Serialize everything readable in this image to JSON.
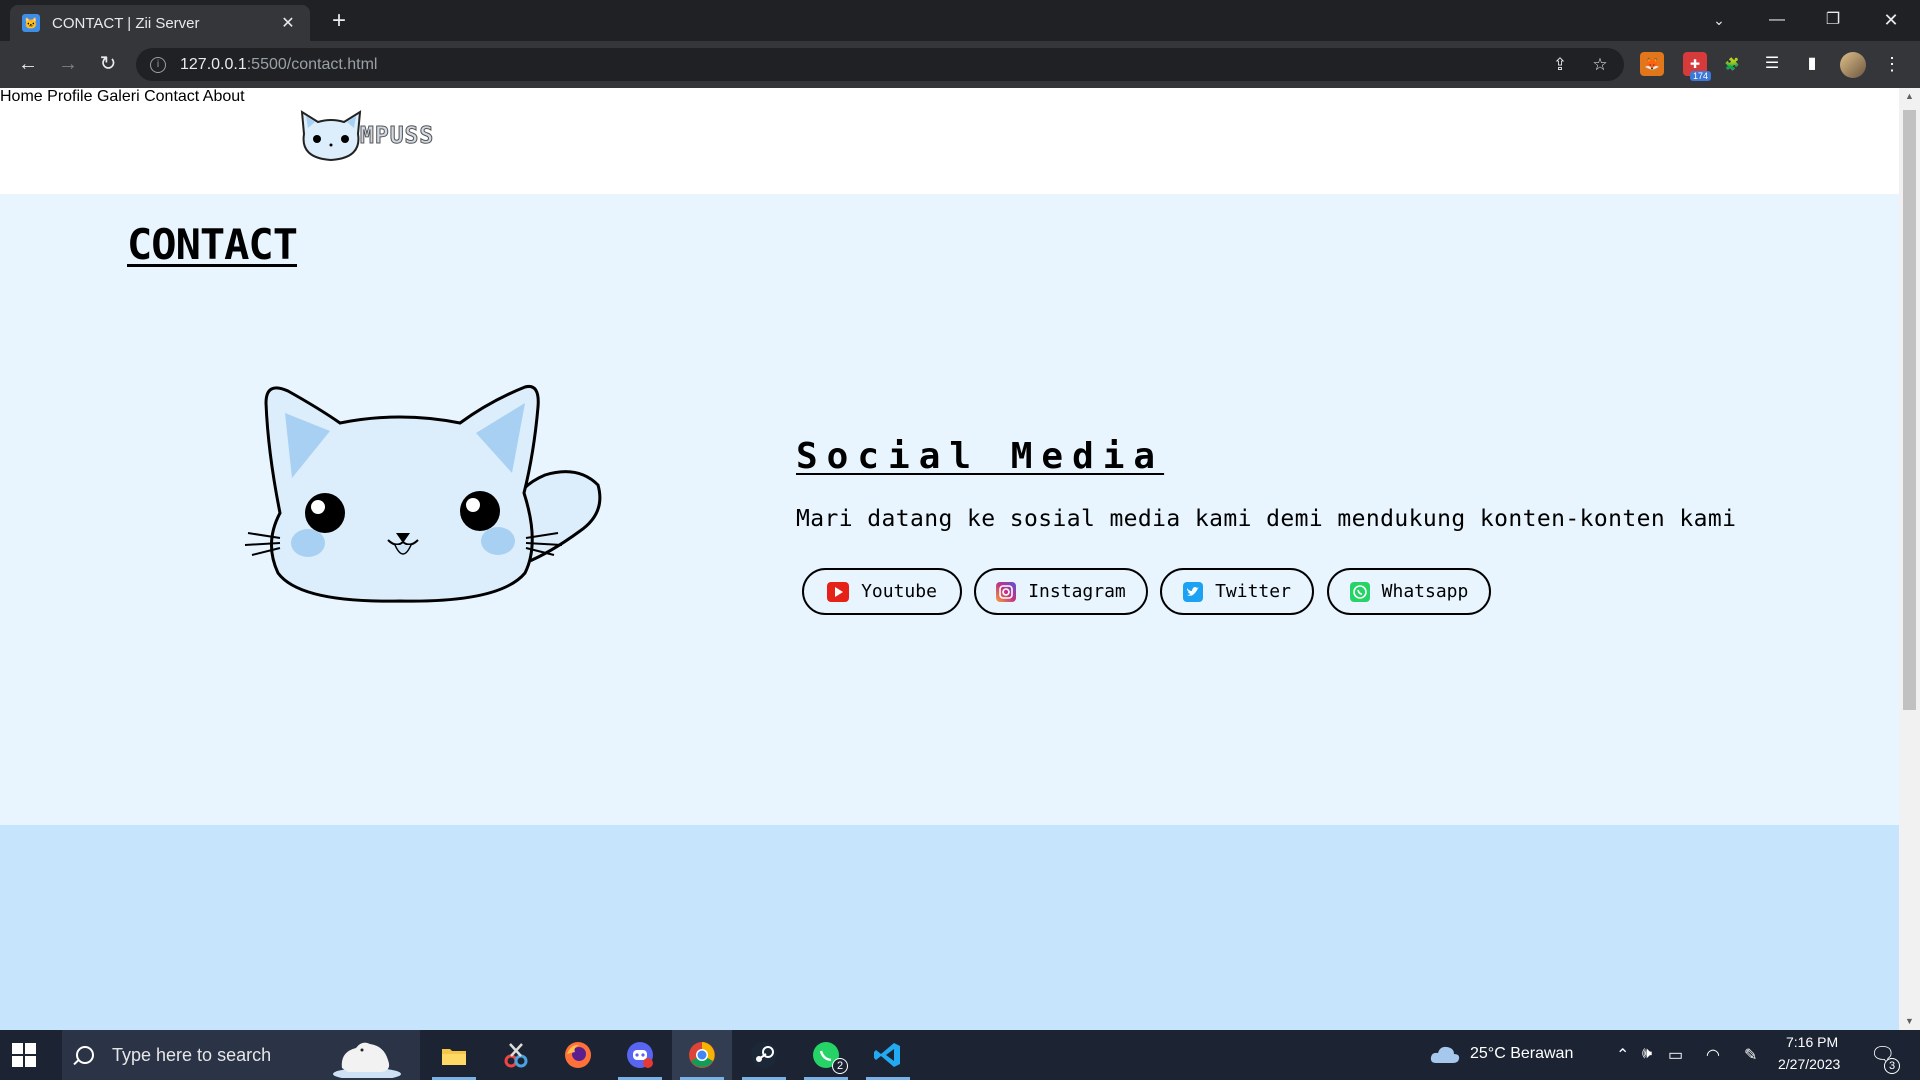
{
  "browser": {
    "tab_title": "CONTACT | Zii Server",
    "tab_close": "✕",
    "new_tab": "+",
    "url_host": "127.0.0.1",
    "url_rest": ":5500/contact.html",
    "extension_badge": "174"
  },
  "site": {
    "logo_text": "MPUSS",
    "nav": [
      {
        "label": "Home"
      },
      {
        "label": "Profile"
      },
      {
        "label": "Galeri"
      },
      {
        "label": "Contact"
      },
      {
        "label": "About"
      }
    ],
    "page_title": "CONTACT",
    "social": {
      "heading": "Social Media",
      "description": "Mari datang ke sosial media kami demi mendukung konten-konten kami",
      "buttons": [
        {
          "label": "Youtube",
          "icon": "youtube-icon",
          "color": "#e62117"
        },
        {
          "label": "Instagram",
          "icon": "instagram-icon",
          "color": "#c13584"
        },
        {
          "label": "Twitter",
          "icon": "twitter-icon",
          "color": "#1da1f2"
        },
        {
          "label": "Whatsapp",
          "icon": "whatsapp-icon",
          "color": "#25d366"
        }
      ]
    },
    "colors": {
      "content_bg": "#e8f5fe",
      "footer_bg": "#c6e4fb",
      "nav_link": "#1565a0",
      "cat_fill": "#dcedfb",
      "cat_accent": "#a8d0f3"
    }
  },
  "taskbar": {
    "search_placeholder": "Type here to search",
    "weather": "25°C  Berawan",
    "time": "7:16 PM",
    "date": "2/27/2023",
    "notification_count": "3",
    "whatsapp_badge": "2"
  }
}
